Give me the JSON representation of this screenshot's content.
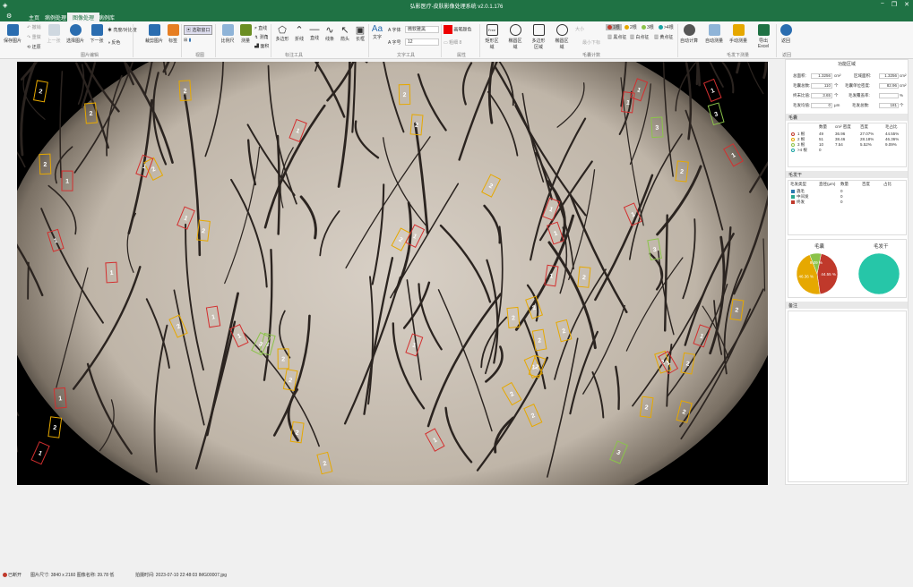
{
  "window": {
    "title": "弘影医疗-皮肤影像处理系统 v2.0.1.176",
    "min": "−",
    "max": "❐",
    "close": "✕"
  },
  "tabs": [
    "主页",
    "病例处理",
    "图像处理",
    "病例库"
  ],
  "ribbon": {
    "save": "保存图片",
    "undo": "撤销",
    "redo": "重做",
    "restore": "还原",
    "prev": "上一张",
    "select": "选择图片",
    "next": "下一张",
    "brightness": "亮度/对比度",
    "invert": "反色",
    "crop": "裁剪图片",
    "mark": "标签",
    "select_window": "选取窗口",
    "ratio": "比例尺",
    "measure": "测量",
    "straight": "≠ 直线",
    "angle": "↯ 测角",
    "area": "▟ 面积",
    "polygon": "多边形",
    "polyline": "折线",
    "line": "直线",
    "curve": "线条",
    "arrow": "箭头",
    "rect": "长框",
    "text": "文字",
    "font": "字体",
    "font_value": "微软雅黑",
    "size": "字号",
    "size_value": "12",
    "color_label": "画笔颜色",
    "thickness_label": "粗细",
    "thickness_value": "8",
    "free": "Free",
    "rect_region": "矩形区域",
    "ellipse_region": "椭圆区域",
    "poly_region": "多边形区域",
    "oval_region": "椭圆区域",
    "hair_1": "1根",
    "hair_2": "2根",
    "hair_3": "3根",
    "hair_4": ">4根",
    "size_label": "大小",
    "threshold_label": "最小下标",
    "black_dot": "黑点征",
    "white_dot": "白点征",
    "yellow_dot": "黄点征",
    "auto_calc": "自动计算",
    "auto_measure": "自动测量",
    "manual_measure": "手动测量",
    "export": "导出Excel",
    "back": "返回",
    "groups": [
      "图片编辑",
      "视图",
      "标注工具",
      "文字工具",
      "属性",
      "毛囊计数",
      "毛发下测量",
      "返回"
    ]
  },
  "panel": {
    "title": "功能区域",
    "fields": [
      {
        "label": "总面积:",
        "value": "1.3256",
        "unit": "cm²"
      },
      {
        "label": "区域面积:",
        "value": "1.3256",
        "unit": "cm²"
      },
      {
        "label": "毛囊总数:",
        "value": "110",
        "unit": "个"
      },
      {
        "label": "毛囊单位密度:",
        "value": "82.96",
        "unit": "cm²"
      },
      {
        "label": "终末比值:",
        "value": "3.65",
        "unit": "个"
      },
      {
        "label": "毛发覆盖率:",
        "value": "",
        "unit": "%"
      },
      {
        "label": "毛发均值:",
        "value": "0",
        "unit": "μm"
      },
      {
        "label": "毛发总数:",
        "value": "181",
        "unit": "个"
      }
    ],
    "follicle_title": "毛囊",
    "follicle_headers": [
      "",
      "数量",
      "cm² 密度",
      "百度",
      "毛占比"
    ],
    "follicle_rows": [
      {
        "name": "1 根",
        "count": "49",
        "density": "36.96",
        "pct": "27.07%",
        "ratio": "44.55%",
        "color": "#c0392b"
      },
      {
        "name": "2 根",
        "count": "51",
        "density": "38.46",
        "pct": "28.18%",
        "ratio": "46.36%",
        "color": "#e6a800"
      },
      {
        "name": "3 根",
        "count": "10",
        "density": "7.54",
        "pct": "5.52%",
        "ratio": "9.09%",
        "color": "#8bc34a"
      },
      {
        "name": ">4 根",
        "count": "0",
        "density": "",
        "pct": "",
        "ratio": "",
        "color": "#1aa3a3"
      }
    ],
    "hairshaft_title": "毛发干",
    "hairshaft_headers": [
      "毛发类型",
      "直径(μm)",
      "数量",
      "百度",
      "占比"
    ],
    "hairshaft_rows": [
      {
        "name": "毳毛",
        "count": "0",
        "color": "#2a7ab0"
      },
      {
        "name": "中间发",
        "count": "0",
        "color": "#2aa88f"
      },
      {
        "name": "终发",
        "count": "0",
        "color": "#c0392b"
      }
    ],
    "pie1_title": "毛囊",
    "pie2_title": "毛发干",
    "pie_labels": {
      "red": "44.55 %",
      "yellow": "46.36 %",
      "green": "9.09 %"
    },
    "notes_title": "备注"
  },
  "chart_data": [
    {
      "type": "pie",
      "title": "毛囊",
      "categories": [
        "1 根",
        "2 根",
        "3 根"
      ],
      "values": [
        44.55,
        46.36,
        9.09
      ],
      "colors": [
        "#c0392b",
        "#e6a800",
        "#8bc34a"
      ]
    },
    {
      "type": "pie",
      "title": "毛发干",
      "categories": [
        "毳毛"
      ],
      "values": [
        100
      ],
      "colors": [
        "#26c6a8"
      ]
    }
  ],
  "status": {
    "connection": "已断开",
    "size": "图片尺寸: 3840 x 2160  图像名称: 39.78 低",
    "time": "拍摄时间: 2023-07-10 22:48:03  IMG00007.jpg"
  }
}
